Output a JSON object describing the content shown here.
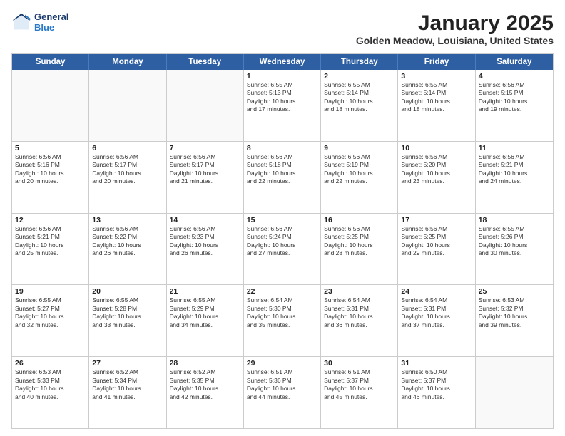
{
  "header": {
    "logo_line1": "General",
    "logo_line2": "Blue",
    "month": "January 2025",
    "location": "Golden Meadow, Louisiana, United States"
  },
  "days_of_week": [
    "Sunday",
    "Monday",
    "Tuesday",
    "Wednesday",
    "Thursday",
    "Friday",
    "Saturday"
  ],
  "rows": [
    [
      {
        "day": "",
        "lines": []
      },
      {
        "day": "",
        "lines": []
      },
      {
        "day": "",
        "lines": []
      },
      {
        "day": "1",
        "lines": [
          "Sunrise: 6:55 AM",
          "Sunset: 5:13 PM",
          "Daylight: 10 hours",
          "and 17 minutes."
        ]
      },
      {
        "day": "2",
        "lines": [
          "Sunrise: 6:55 AM",
          "Sunset: 5:14 PM",
          "Daylight: 10 hours",
          "and 18 minutes."
        ]
      },
      {
        "day": "3",
        "lines": [
          "Sunrise: 6:55 AM",
          "Sunset: 5:14 PM",
          "Daylight: 10 hours",
          "and 18 minutes."
        ]
      },
      {
        "day": "4",
        "lines": [
          "Sunrise: 6:56 AM",
          "Sunset: 5:15 PM",
          "Daylight: 10 hours",
          "and 19 minutes."
        ]
      }
    ],
    [
      {
        "day": "5",
        "lines": [
          "Sunrise: 6:56 AM",
          "Sunset: 5:16 PM",
          "Daylight: 10 hours",
          "and 20 minutes."
        ]
      },
      {
        "day": "6",
        "lines": [
          "Sunrise: 6:56 AM",
          "Sunset: 5:17 PM",
          "Daylight: 10 hours",
          "and 20 minutes."
        ]
      },
      {
        "day": "7",
        "lines": [
          "Sunrise: 6:56 AM",
          "Sunset: 5:17 PM",
          "Daylight: 10 hours",
          "and 21 minutes."
        ]
      },
      {
        "day": "8",
        "lines": [
          "Sunrise: 6:56 AM",
          "Sunset: 5:18 PM",
          "Daylight: 10 hours",
          "and 22 minutes."
        ]
      },
      {
        "day": "9",
        "lines": [
          "Sunrise: 6:56 AM",
          "Sunset: 5:19 PM",
          "Daylight: 10 hours",
          "and 22 minutes."
        ]
      },
      {
        "day": "10",
        "lines": [
          "Sunrise: 6:56 AM",
          "Sunset: 5:20 PM",
          "Daylight: 10 hours",
          "and 23 minutes."
        ]
      },
      {
        "day": "11",
        "lines": [
          "Sunrise: 6:56 AM",
          "Sunset: 5:21 PM",
          "Daylight: 10 hours",
          "and 24 minutes."
        ]
      }
    ],
    [
      {
        "day": "12",
        "lines": [
          "Sunrise: 6:56 AM",
          "Sunset: 5:21 PM",
          "Daylight: 10 hours",
          "and 25 minutes."
        ]
      },
      {
        "day": "13",
        "lines": [
          "Sunrise: 6:56 AM",
          "Sunset: 5:22 PM",
          "Daylight: 10 hours",
          "and 26 minutes."
        ]
      },
      {
        "day": "14",
        "lines": [
          "Sunrise: 6:56 AM",
          "Sunset: 5:23 PM",
          "Daylight: 10 hours",
          "and 26 minutes."
        ]
      },
      {
        "day": "15",
        "lines": [
          "Sunrise: 6:56 AM",
          "Sunset: 5:24 PM",
          "Daylight: 10 hours",
          "and 27 minutes."
        ]
      },
      {
        "day": "16",
        "lines": [
          "Sunrise: 6:56 AM",
          "Sunset: 5:25 PM",
          "Daylight: 10 hours",
          "and 28 minutes."
        ]
      },
      {
        "day": "17",
        "lines": [
          "Sunrise: 6:56 AM",
          "Sunset: 5:25 PM",
          "Daylight: 10 hours",
          "and 29 minutes."
        ]
      },
      {
        "day": "18",
        "lines": [
          "Sunrise: 6:55 AM",
          "Sunset: 5:26 PM",
          "Daylight: 10 hours",
          "and 30 minutes."
        ]
      }
    ],
    [
      {
        "day": "19",
        "lines": [
          "Sunrise: 6:55 AM",
          "Sunset: 5:27 PM",
          "Daylight: 10 hours",
          "and 32 minutes."
        ]
      },
      {
        "day": "20",
        "lines": [
          "Sunrise: 6:55 AM",
          "Sunset: 5:28 PM",
          "Daylight: 10 hours",
          "and 33 minutes."
        ]
      },
      {
        "day": "21",
        "lines": [
          "Sunrise: 6:55 AM",
          "Sunset: 5:29 PM",
          "Daylight: 10 hours",
          "and 34 minutes."
        ]
      },
      {
        "day": "22",
        "lines": [
          "Sunrise: 6:54 AM",
          "Sunset: 5:30 PM",
          "Daylight: 10 hours",
          "and 35 minutes."
        ]
      },
      {
        "day": "23",
        "lines": [
          "Sunrise: 6:54 AM",
          "Sunset: 5:31 PM",
          "Daylight: 10 hours",
          "and 36 minutes."
        ]
      },
      {
        "day": "24",
        "lines": [
          "Sunrise: 6:54 AM",
          "Sunset: 5:31 PM",
          "Daylight: 10 hours",
          "and 37 minutes."
        ]
      },
      {
        "day": "25",
        "lines": [
          "Sunrise: 6:53 AM",
          "Sunset: 5:32 PM",
          "Daylight: 10 hours",
          "and 39 minutes."
        ]
      }
    ],
    [
      {
        "day": "26",
        "lines": [
          "Sunrise: 6:53 AM",
          "Sunset: 5:33 PM",
          "Daylight: 10 hours",
          "and 40 minutes."
        ]
      },
      {
        "day": "27",
        "lines": [
          "Sunrise: 6:52 AM",
          "Sunset: 5:34 PM",
          "Daylight: 10 hours",
          "and 41 minutes."
        ]
      },
      {
        "day": "28",
        "lines": [
          "Sunrise: 6:52 AM",
          "Sunset: 5:35 PM",
          "Daylight: 10 hours",
          "and 42 minutes."
        ]
      },
      {
        "day": "29",
        "lines": [
          "Sunrise: 6:51 AM",
          "Sunset: 5:36 PM",
          "Daylight: 10 hours",
          "and 44 minutes."
        ]
      },
      {
        "day": "30",
        "lines": [
          "Sunrise: 6:51 AM",
          "Sunset: 5:37 PM",
          "Daylight: 10 hours",
          "and 45 minutes."
        ]
      },
      {
        "day": "31",
        "lines": [
          "Sunrise: 6:50 AM",
          "Sunset: 5:37 PM",
          "Daylight: 10 hours",
          "and 46 minutes."
        ]
      },
      {
        "day": "",
        "lines": []
      }
    ]
  ]
}
